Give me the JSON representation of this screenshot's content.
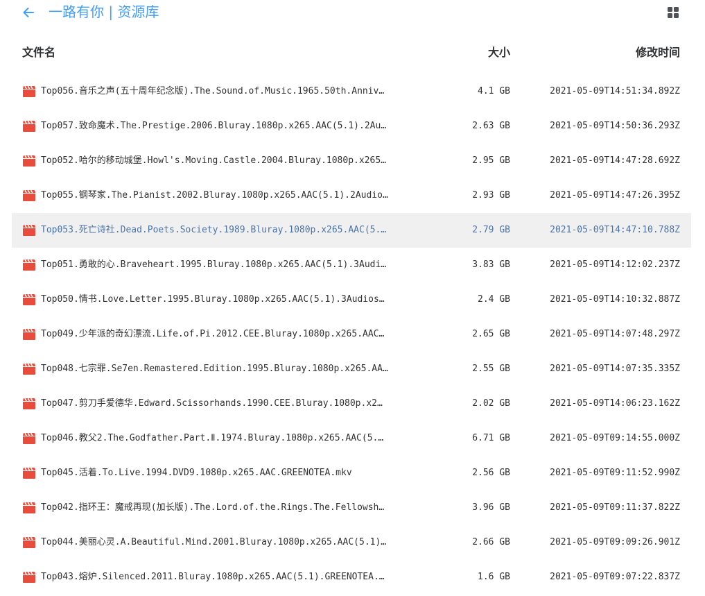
{
  "header": {
    "title": "一路有你 | 资源库",
    "back_icon": "arrow-left-icon",
    "view_icon": "grid-view-icon",
    "accent_color": "#409eff"
  },
  "columns": {
    "name": "文件名",
    "size": "大小",
    "modified": "修改时间"
  },
  "files": [
    {
      "name": "Top056.音乐之声(五十周年纪念版).The.Sound.of.Music.1965.50th.Anniv…",
      "size": "4.1 GB",
      "modified": "2021-05-09T14:51:34.892Z"
    },
    {
      "name": "Top057.致命魔术.The.Prestige.2006.Bluray.1080p.x265.AAC(5.1).2Au…",
      "size": "2.63 GB",
      "modified": "2021-05-09T14:50:36.293Z"
    },
    {
      "name": "Top052.哈尔的移动城堡.Howl's.Moving.Castle.2004.Bluray.1080p.x265…",
      "size": "2.95 GB",
      "modified": "2021-05-09T14:47:28.692Z"
    },
    {
      "name": "Top055.钢琴家.The.Pianist.2002.Bluray.1080p.x265.AAC(5.1).2Audio…",
      "size": "2.93 GB",
      "modified": "2021-05-09T14:47:26.395Z"
    },
    {
      "name": "Top053.死亡诗社.Dead.Poets.Society.1989.Bluray.1080p.x265.AAC(5.…",
      "size": "2.79 GB",
      "modified": "2021-05-09T14:47:10.788Z",
      "active": true
    },
    {
      "name": "Top051.勇敢的心.Braveheart.1995.Bluray.1080p.x265.AAC(5.1).3Audi…",
      "size": "3.83 GB",
      "modified": "2021-05-09T14:12:02.237Z"
    },
    {
      "name": "Top050.情书.Love.Letter.1995.Bluray.1080p.x265.AAC(5.1).3Audios…",
      "size": "2.4 GB",
      "modified": "2021-05-09T14:10:32.887Z"
    },
    {
      "name": "Top049.少年派的奇幻漂流.Life.of.Pi.2012.CEE.Bluray.1080p.x265.AAC…",
      "size": "2.65 GB",
      "modified": "2021-05-09T14:07:48.297Z"
    },
    {
      "name": "Top048.七宗罪.Se7en.Remastered.Edition.1995.Bluray.1080p.x265.AA…",
      "size": "2.55 GB",
      "modified": "2021-05-09T14:07:35.335Z"
    },
    {
      "name": "Top047.剪刀手爱德华.Edward.Scissorhands.1990.CEE.Bluray.1080p.x2…",
      "size": "2.02 GB",
      "modified": "2021-05-09T14:06:23.162Z"
    },
    {
      "name": "Top046.教父2.The.Godfather.Part.Ⅱ.1974.Bluray.1080p.x265.AAC(5.…",
      "size": "6.71 GB",
      "modified": "2021-05-09T09:14:55.000Z"
    },
    {
      "name": "Top045.活着.To.Live.1994.DVD9.1080p.x265.AAC.GREENOTEA.mkv",
      "size": "2.56 GB",
      "modified": "2021-05-09T09:11:52.990Z"
    },
    {
      "name": "Top042.指环王：魔戒再现(加长版).The.Lord.of.the.Rings.The.Fellowsh…",
      "size": "3.96 GB",
      "modified": "2021-05-09T09:11:37.822Z"
    },
    {
      "name": "Top044.美丽心灵.A.Beautiful.Mind.2001.Bluray.1080p.x265.AAC(5.1)…",
      "size": "2.66 GB",
      "modified": "2021-05-09T09:09:26.901Z"
    },
    {
      "name": "Top043.熔炉.Silenced.2011.Bluray.1080p.x265.AAC(5.1).GREENOTEA.…",
      "size": "1.6 GB",
      "modified": "2021-05-09T09:07:22.837Z"
    }
  ],
  "file_icon": "video-file-icon",
  "icon_color": "#e74c3c",
  "highlight_text_color": "#4a74a8"
}
